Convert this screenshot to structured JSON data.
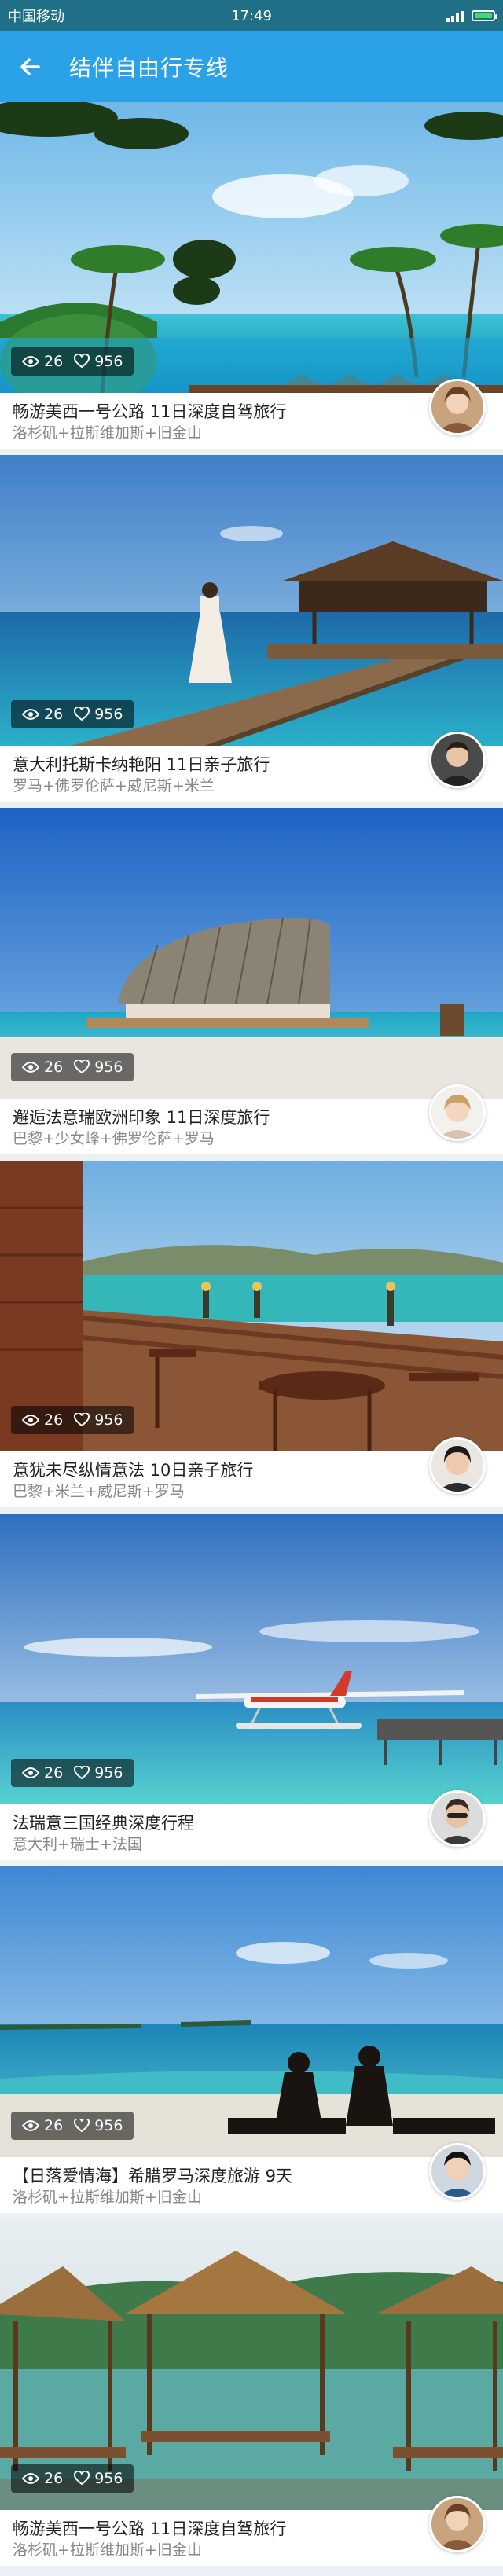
{
  "status_bar": {
    "carrier": "中国移动",
    "time": "17:49"
  },
  "app_bar": {
    "title": "结伴自由行专线"
  },
  "colors": {
    "primary": "#2ba2e7",
    "status": "#1f6f86",
    "battery": "#43d96b"
  },
  "trips": [
    {
      "title": "畅游美西一号公路 11日深度自驾旅行",
      "route": "洛杉矶+拉斯维加斯+旧金山",
      "views": "26",
      "likes": "956"
    },
    {
      "title": "意大利托斯卡纳艳阳 11日亲子旅行",
      "route": "罗马+佛罗伦萨+威尼斯+米兰",
      "views": "26",
      "likes": "956"
    },
    {
      "title": "邂逅法意瑞欧洲印象 11日深度旅行",
      "route": "巴黎+少女峰+佛罗伦萨+罗马",
      "views": "26",
      "likes": "956"
    },
    {
      "title": "意犹未尽纵情意法 10日亲子旅行",
      "route": "巴黎+米兰+威尼斯+罗马",
      "views": "26",
      "likes": "956"
    },
    {
      "title": "法瑞意三国经典深度行程",
      "route": "意大利+瑞士+法国",
      "views": "26",
      "likes": "956"
    },
    {
      "title": "【日落爱情海】希腊罗马深度旅游 9天",
      "route": "洛杉矶+拉斯维加斯+旧金山",
      "views": "26",
      "likes": "956"
    },
    {
      "title": "畅游美西一号公路 11日深度自驾旅行",
      "route": "洛杉矶+拉斯维加斯+旧金山",
      "views": "26",
      "likes": "956"
    }
  ]
}
